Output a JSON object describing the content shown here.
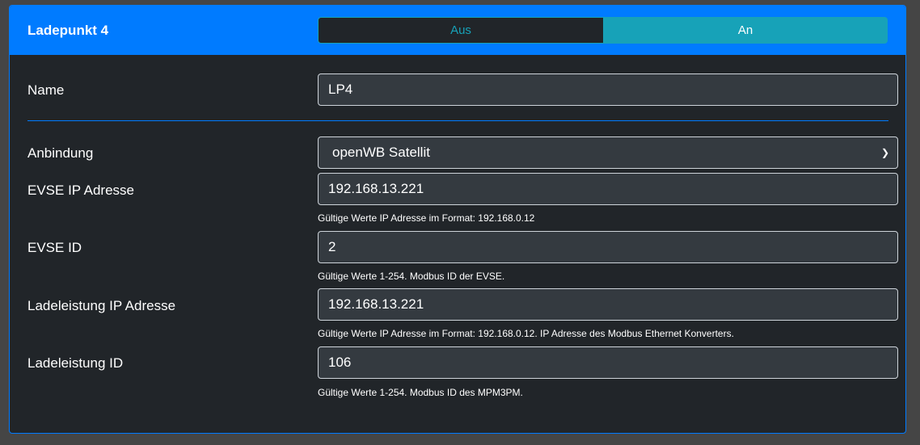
{
  "header": {
    "title": "Ladepunkt 4",
    "toggle": {
      "off_label": "Aus",
      "on_label": "An",
      "selected": "An"
    }
  },
  "fields": {
    "name": {
      "label": "Name",
      "value": "LP4"
    },
    "anbindung": {
      "label": "Anbindung",
      "value": "openWB Satellit"
    },
    "evse_ip": {
      "label": "EVSE IP Adresse",
      "value": "192.168.13.221",
      "help": "Gültige Werte IP Adresse im Format: 192.168.0.12"
    },
    "evse_id": {
      "label": "EVSE ID",
      "value": "2",
      "help": "Gültige Werte 1-254. Modbus ID der EVSE."
    },
    "ll_ip": {
      "label": "Ladeleistung IP Adresse",
      "value": "192.168.13.221",
      "help": "Gültige Werte IP Adresse im Format: 192.168.0.12. IP Adresse des Modbus Ethernet Konverters."
    },
    "ll_id": {
      "label": "Ladeleistung ID",
      "value": "106",
      "help": "Gültige Werte 1-254. Modbus ID des MPM3PM."
    }
  }
}
